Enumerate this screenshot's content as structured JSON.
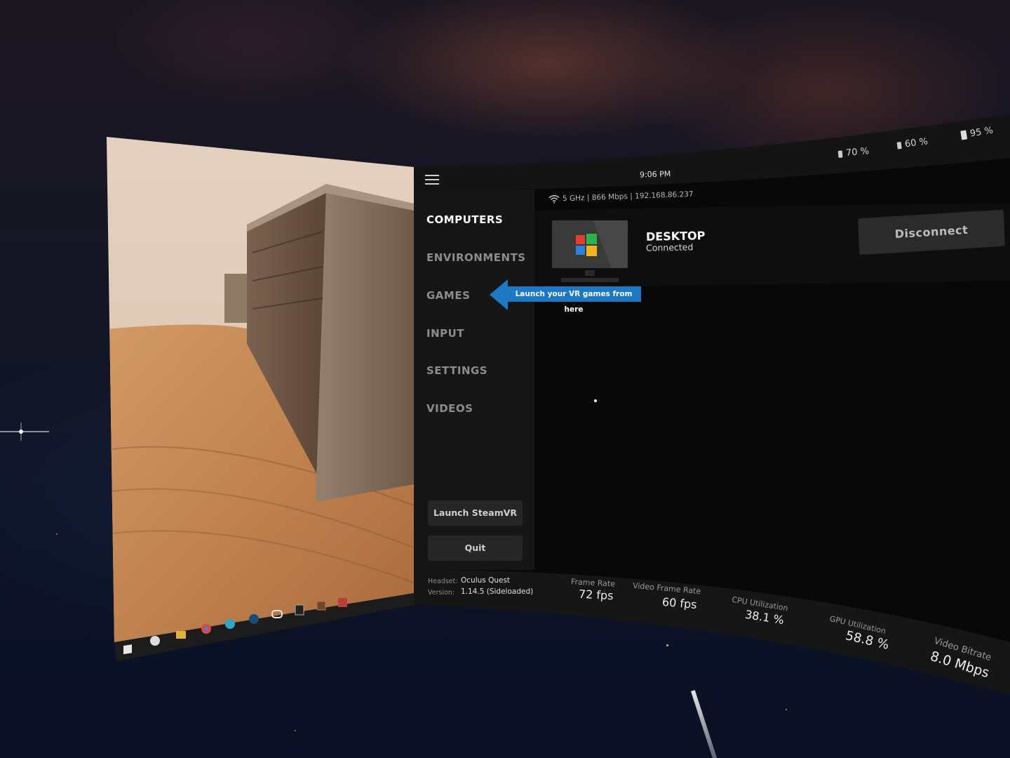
{
  "status_bar": {
    "time": "9:06 PM",
    "wifi": "5 GHz | 866 Mbps | 192.168.86.237",
    "batteries": [
      {
        "icon": "controller-battery-icon",
        "value": "70 %"
      },
      {
        "icon": "controller-battery-icon",
        "value": "60 %"
      },
      {
        "icon": "headset-battery-icon",
        "value": "95 %"
      }
    ]
  },
  "sidebar": {
    "items": [
      {
        "label": "COMPUTERS",
        "active": true
      },
      {
        "label": "ENVIRONMENTS",
        "active": false
      },
      {
        "label": "GAMES",
        "active": false
      },
      {
        "label": "INPUT",
        "active": false
      },
      {
        "label": "SETTINGS",
        "active": false
      },
      {
        "label": "VIDEOS",
        "active": false
      }
    ],
    "tooltip": "Launch your VR games from here",
    "launch_steamvr": "Launch SteamVR",
    "quit": "Quit"
  },
  "computer": {
    "name": "DESKTOP",
    "status": "Connected",
    "disconnect": "Disconnect"
  },
  "footer": {
    "headset_label": "Headset:",
    "headset_value": "Oculus Quest",
    "version_label": "Version:",
    "version_value": "1.14.5 (Sideloaded)",
    "metrics": [
      {
        "label": "Frame Rate",
        "value": "72 fps"
      },
      {
        "label": "Video Frame Rate",
        "value": "60 fps"
      },
      {
        "label": "CPU Utilization",
        "value": "38.1 %"
      },
      {
        "label": "GPU Utilization",
        "value": "58.8 %"
      },
      {
        "label": "Video Bitrate",
        "value": "8.0 Mbps"
      }
    ]
  },
  "taskbar": {
    "icons": [
      "windows-start-icon",
      "photos-icon",
      "file-explorer-icon",
      "chrome-icon",
      "edge-icon",
      "steam-icon",
      "oculus-icon",
      "epic-games-icon",
      "app-icon",
      "app-icon"
    ]
  },
  "colors": {
    "accent": "#1d78c1",
    "panel": "#0b0b0b",
    "sidebar": "#141414"
  }
}
